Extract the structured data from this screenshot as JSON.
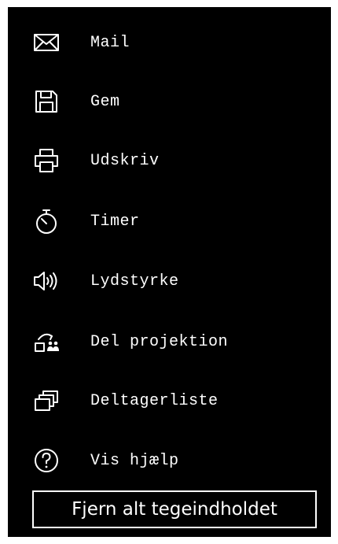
{
  "theme": {
    "background": "#000000",
    "foreground": "#ffffff"
  },
  "menu": {
    "items": [
      {
        "label": "Mail",
        "icon": "mail-icon"
      },
      {
        "label": "Gem",
        "icon": "save-icon"
      },
      {
        "label": "Udskriv",
        "icon": "printer-icon"
      },
      {
        "label": "Timer",
        "icon": "stopwatch-icon"
      },
      {
        "label": "Lydstyrke",
        "icon": "volume-icon"
      },
      {
        "label": "Del projektion",
        "icon": "share-projection-icon"
      },
      {
        "label": "Deltagerliste",
        "icon": "participant-list-icon"
      },
      {
        "label": "Vis hjælp",
        "icon": "help-icon"
      }
    ]
  },
  "footer": {
    "clear_label": "Fjern alt tegeindholdet"
  }
}
